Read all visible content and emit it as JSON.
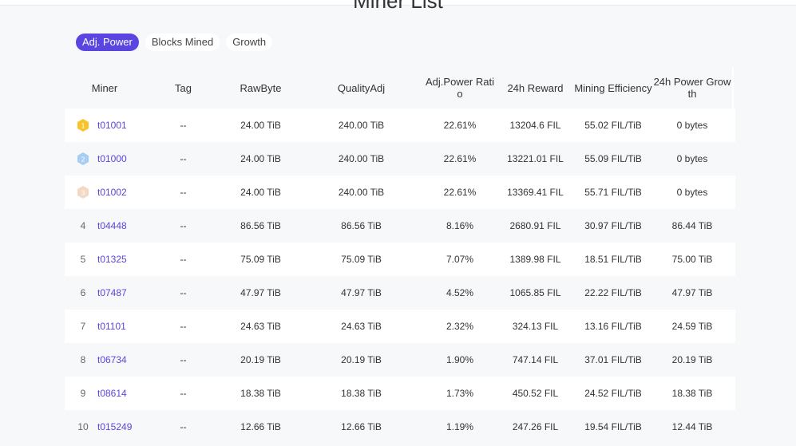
{
  "page": {
    "title": "Miner List"
  },
  "tabs": [
    {
      "label": "Adj. Power",
      "active": true
    },
    {
      "label": "Blocks Mined",
      "active": false
    },
    {
      "label": "Growth",
      "active": false
    }
  ],
  "table": {
    "headers": [
      "Miner",
      "Tag",
      "RawByte",
      "QualityAdj",
      "Adj.Power Ratio",
      "24h Reward",
      "Mining Efficiency",
      "24h Power Growth"
    ],
    "rows": [
      {
        "rank": "1",
        "medal": "gold",
        "miner": "t01001",
        "tag": "--",
        "rawbyte": "24.00 TiB",
        "quality_adj": "240.00 TiB",
        "ratio": "22.61%",
        "reward": "13204.6 FIL",
        "efficiency": "55.02 FIL/TiB",
        "growth": "0 bytes"
      },
      {
        "rank": "2",
        "medal": "silver",
        "miner": "t01000",
        "tag": "--",
        "rawbyte": "24.00 TiB",
        "quality_adj": "240.00 TiB",
        "ratio": "22.61%",
        "reward": "13221.01 FIL",
        "efficiency": "55.09 FIL/TiB",
        "growth": "0 bytes"
      },
      {
        "rank": "3",
        "medal": "bronze",
        "miner": "t01002",
        "tag": "--",
        "rawbyte": "24.00 TiB",
        "quality_adj": "240.00 TiB",
        "ratio": "22.61%",
        "reward": "13369.41 FIL",
        "efficiency": "55.71 FIL/TiB",
        "growth": "0 bytes"
      },
      {
        "rank": "4",
        "medal": "",
        "miner": "t04448",
        "tag": "--",
        "rawbyte": "86.56 TiB",
        "quality_adj": "86.56 TiB",
        "ratio": "8.16%",
        "reward": "2680.91 FIL",
        "efficiency": "30.97 FIL/TiB",
        "growth": "86.44 TiB"
      },
      {
        "rank": "5",
        "medal": "",
        "miner": "t01325",
        "tag": "--",
        "rawbyte": "75.09 TiB",
        "quality_adj": "75.09 TiB",
        "ratio": "7.07%",
        "reward": "1389.98 FIL",
        "efficiency": "18.51 FIL/TiB",
        "growth": "75.00 TiB"
      },
      {
        "rank": "6",
        "medal": "",
        "miner": "t07487",
        "tag": "--",
        "rawbyte": "47.97 TiB",
        "quality_adj": "47.97 TiB",
        "ratio": "4.52%",
        "reward": "1065.85 FIL",
        "efficiency": "22.22 FIL/TiB",
        "growth": "47.97 TiB"
      },
      {
        "rank": "7",
        "medal": "",
        "miner": "t01101",
        "tag": "--",
        "rawbyte": "24.63 TiB",
        "quality_adj": "24.63 TiB",
        "ratio": "2.32%",
        "reward": "324.13 FIL",
        "efficiency": "13.16 FIL/TiB",
        "growth": "24.59 TiB"
      },
      {
        "rank": "8",
        "medal": "",
        "miner": "t06734",
        "tag": "--",
        "rawbyte": "20.19 TiB",
        "quality_adj": "20.19 TiB",
        "ratio": "1.90%",
        "reward": "747.14 FIL",
        "efficiency": "37.01 FIL/TiB",
        "growth": "20.19 TiB"
      },
      {
        "rank": "9",
        "medal": "",
        "miner": "t08614",
        "tag": "--",
        "rawbyte": "18.38 TiB",
        "quality_adj": "18.38 TiB",
        "ratio": "1.73%",
        "reward": "450.52 FIL",
        "efficiency": "24.52 FIL/TiB",
        "growth": "18.38 TiB"
      },
      {
        "rank": "10",
        "medal": "",
        "miner": "t015249",
        "tag": "--",
        "rawbyte": "12.66 TiB",
        "quality_adj": "12.66 TiB",
        "ratio": "1.19%",
        "reward": "247.26 FIL",
        "efficiency": "19.54 FIL/TiB",
        "growth": "12.44 TiB"
      }
    ]
  },
  "colors": {
    "accent": "#5b45e0",
    "gold": "#f7c52b",
    "silver": "#a8cdf5",
    "bronze": "#f3d9c4"
  }
}
